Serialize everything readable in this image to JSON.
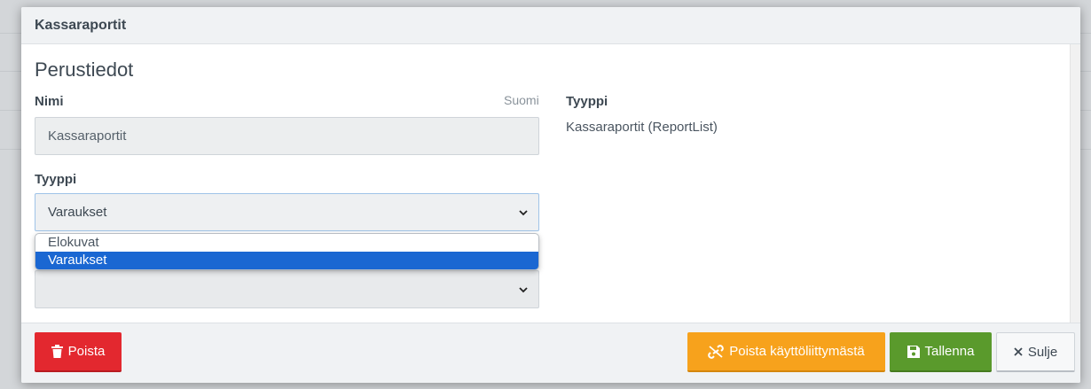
{
  "modal": {
    "title": "Kassaraportit"
  },
  "section": {
    "title": "Perustiedot"
  },
  "name_field": {
    "label": "Nimi",
    "language": "Suomi",
    "value": "Kassaraportit"
  },
  "type_select": {
    "label": "Tyyppi",
    "selected": "Varaukset",
    "options": [
      "Elokuvat",
      "Varaukset"
    ]
  },
  "info": {
    "type_label": "Tyyppi",
    "type_value": "Kassaraportit (ReportList)"
  },
  "footer": {
    "delete_label": "Poista",
    "detach_label": "Poista käyttöliittymästä",
    "save_label": "Tallenna",
    "close_label": "Sulje"
  },
  "colors": {
    "danger": "#e3282f",
    "warning": "#f7a21c",
    "success": "#5a9a2c",
    "selection": "#1a67d2"
  },
  "icons": {
    "delete": "trash-icon",
    "detach": "unlink-icon",
    "save": "floppy-disk-icon",
    "close": "close-icon",
    "select": "chevron-down-icon"
  }
}
